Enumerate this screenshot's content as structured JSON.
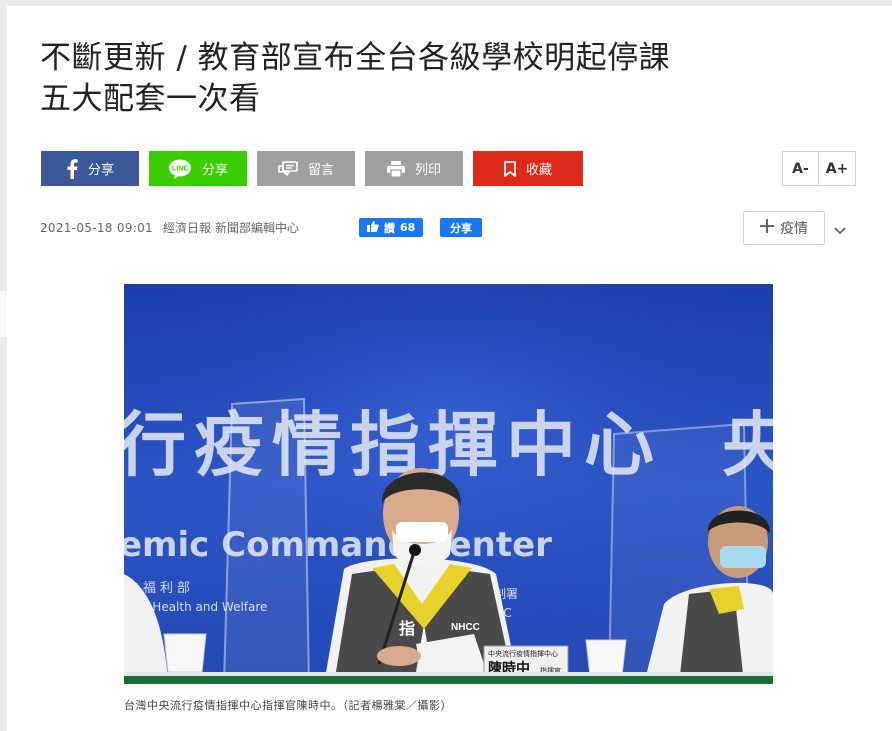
{
  "article": {
    "title_line1": "不斷更新 / 教育部宣布全台各級學校明起停課",
    "title_line2": "五大配套一次看",
    "date": "2021-05-18 09:01",
    "source": "經濟日報",
    "author": "新聞部編輯中心"
  },
  "share_bar": {
    "facebook_label": "分享",
    "line_label": "分享",
    "line_logo_text": "LINE",
    "comment_label": "留言",
    "print_label": "列印",
    "save_label": "收藏",
    "font_decrease": "A-",
    "font_increase": "A+"
  },
  "social": {
    "like_label": "讚",
    "like_count": "68",
    "share_label": "分享"
  },
  "tag": {
    "icon": "plus-icon",
    "label": "疫情"
  },
  "photo": {
    "backdrop_text_cn": "行疫情指揮中心",
    "backdrop_text_en": "emic Command Center",
    "backdrop_far_left_cn": "生福利部",
    "backdrop_far_left_en": "y of Health and Welfare",
    "right_partial_cn": "央",
    "vest_badge": "NHCC",
    "vest_text": "指",
    "nameplate_org": "中央流行疫情指揮中心",
    "nameplate_name": "陳時中",
    "nameplate_title": "指揮官",
    "sign_partial": "制署",
    "sign_partial2": "DC"
  },
  "caption": "台灣中央流行疫情指揮中心指揮官陳時中。（記者楊雅棠／攝影）",
  "colors": {
    "facebook": "#3b5998",
    "line": "#3acd01",
    "gray_button": "#a0a0a0",
    "save_red": "#dd2a1b",
    "fb_blue": "#1877f2"
  }
}
